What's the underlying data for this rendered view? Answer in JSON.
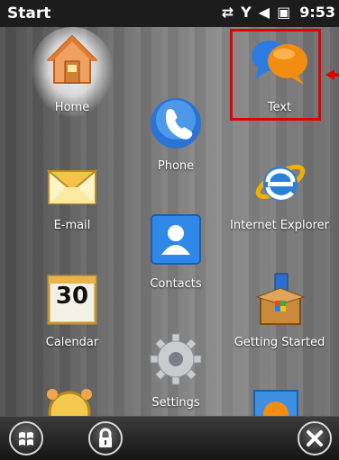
{
  "statusbar": {
    "title": "Start",
    "time": "9:53",
    "icons": [
      "data-connection-icon",
      "signal-icon",
      "speaker-icon",
      "battery-icon"
    ]
  },
  "apps": [
    {
      "id": "home",
      "label": "Home",
      "icon": "house-icon"
    },
    {
      "id": "text",
      "label": "Text",
      "icon": "speech-bubbles-icon"
    },
    {
      "id": "phone",
      "label": "Phone",
      "icon": "phone-handset-icon"
    },
    {
      "id": "email",
      "label": "E-mail",
      "icon": "envelope-icon"
    },
    {
      "id": "ie",
      "label": "Internet Explorer",
      "icon": "internet-explorer-icon"
    },
    {
      "id": "contacts",
      "label": "Contacts",
      "icon": "contact-card-icon"
    },
    {
      "id": "calendar",
      "label": "Calendar",
      "icon": "calendar-icon",
      "calendar_day": "30"
    },
    {
      "id": "getting_started",
      "label": "Getting Started",
      "icon": "gift-box-icon"
    },
    {
      "id": "settings",
      "label": "Settings",
      "icon": "gear-icon"
    }
  ],
  "bottombar": {
    "buttons": [
      "windows-start-icon",
      "lock-icon",
      "close-icon"
    ]
  },
  "colors": {
    "highlight": "#e00000",
    "statusbar": "#1c1c1c"
  }
}
